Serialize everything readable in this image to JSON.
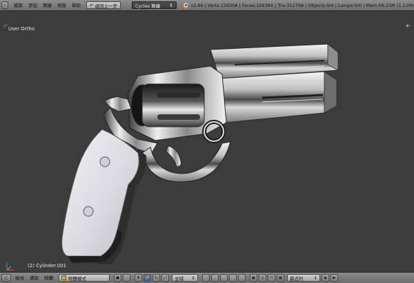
{
  "info_header": {
    "editor_icon": "info-editor-icon",
    "menu": [
      "檔案",
      "添加",
      "算繪",
      "視窗",
      "幫助"
    ],
    "undo_label": "返回上一步",
    "render_engine": "Cycles 算繪",
    "stats": "v2.66 | Verts:156358 | Faces:156384 | Tris:312768 | Objects:0/4 | Lamps:0/0 | Mem:56.23M (1.11M)"
  },
  "viewport": {
    "view_name": "User Ortho",
    "object_name": "(2) Cylinder.001",
    "background": "#3c3c3c"
  },
  "view_header": {
    "menu": [
      "檢視",
      "選取",
      "物體"
    ],
    "mode": "物體模式",
    "orientation": "全域",
    "snap_target": "最近的"
  }
}
